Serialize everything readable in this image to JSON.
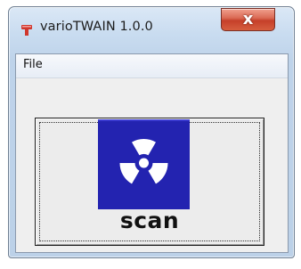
{
  "window": {
    "title": "varioTWAIN 1.0.0",
    "close_label": "x"
  },
  "menu": {
    "items": [
      {
        "label": "File"
      }
    ]
  },
  "scan_button": {
    "label": "scan",
    "icon": "radiation-icon",
    "icon_bg_color": "#2323b0"
  },
  "colors": {
    "close_button": "#c6402a",
    "app_icon": "#c8322a"
  }
}
